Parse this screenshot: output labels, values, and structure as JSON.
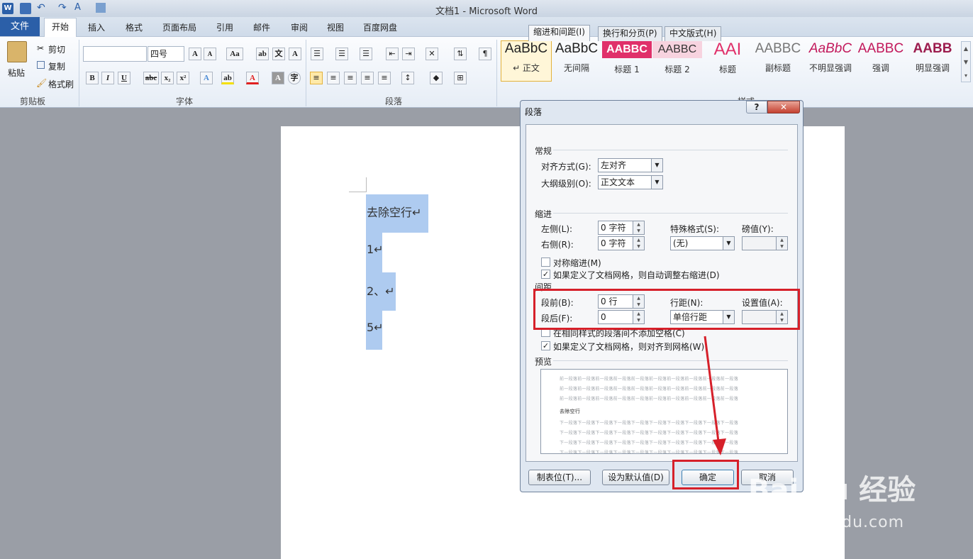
{
  "window": {
    "title": "文档1 - Microsoft Word"
  },
  "tabs": [
    "文件",
    "开始",
    "插入",
    "格式",
    "页面布局",
    "引用",
    "邮件",
    "审阅",
    "视图",
    "百度网盘"
  ],
  "ribbon": {
    "clipboard": {
      "paste": "粘贴",
      "cut": "剪切",
      "copy": "复制",
      "format_painter": "格式刷",
      "label": "剪贴板"
    },
    "font": {
      "font_name": "",
      "font_size": "四号",
      "label": "字体"
    },
    "paragraph": {
      "label": "段落"
    },
    "styles": {
      "label": "样式",
      "items": [
        {
          "sample": "AaBbC",
          "name": "↵ 正文",
          "color": "#222222"
        },
        {
          "sample": "AaBbC",
          "name": "无间隔",
          "color": "#222222"
        },
        {
          "sample": "AABBC",
          "name": "标题 1",
          "color": "#ffffff"
        },
        {
          "sample": "AABBC",
          "name": "标题 2",
          "color": "#333333"
        },
        {
          "sample": "AAI",
          "name": "标题",
          "color": "#e0306a"
        },
        {
          "sample": "AABBC",
          "name": "副标题",
          "color": "#777777"
        },
        {
          "sample": "AaBbC",
          "name": "不明显强调",
          "color": "#c2185b"
        },
        {
          "sample": "AABBC",
          "name": "强调",
          "color": "#c2185b"
        },
        {
          "sample": "AABB",
          "name": "明显强调",
          "color": "#9c1c4e"
        }
      ]
    }
  },
  "document": {
    "lines": [
      "去除空行↵",
      "1↵",
      "2、↵",
      "5↵"
    ]
  },
  "dialog": {
    "title": "段落",
    "help": "?",
    "close": "✕",
    "tabs": [
      "缩进和间距(I)",
      "换行和分页(P)",
      "中文版式(H)"
    ],
    "general": {
      "heading": "常规",
      "alignment_label": "对齐方式(G):",
      "alignment_value": "左对齐",
      "outline_label": "大纲级别(O):",
      "outline_value": "正文文本"
    },
    "indent": {
      "heading": "缩进",
      "left_label": "左侧(L):",
      "left_value": "0 字符",
      "right_label": "右侧(R):",
      "right_value": "0 字符",
      "special_label": "特殊格式(S):",
      "special_value": "(无)",
      "by_label": "磅值(Y):",
      "by_value": "",
      "mirror": "对称缩进(M)",
      "mirror_checked": false,
      "auto_adjust": "如果定义了文档网格，则自动调整右缩进(D)",
      "auto_adjust_checked": true
    },
    "spacing": {
      "heading": "间距",
      "before_label": "段前(B):",
      "before_value": "0 行",
      "after_label": "段后(F):",
      "after_value": "0",
      "line_label": "行距(N):",
      "line_value": "单倍行距",
      "at_label": "设置值(A):",
      "at_value": "",
      "no_space_same_style": "在相同样式的段落间不添加空格(C)",
      "no_space_checked": false,
      "snap_grid": "如果定义了文档网格，则对齐到网格(W)",
      "snap_grid_checked": true
    },
    "preview": {
      "heading": "预览",
      "sample_text": "去除空行",
      "prev_line": "前一段落前一段落前一段落前一段落前一段落前一段落前一段落前一段落前一段落前一段落",
      "next_line": "下一段落下一段落下一段落下一段落下一段落下一段落下一段落下一段落下一段落下一段落"
    },
    "buttons": {
      "tabs": "制表位(T)...",
      "default": "设为默认值(D)",
      "ok": "确定",
      "cancel": "取消"
    }
  },
  "watermark": {
    "brand": "Bai  du 经验",
    "url": "jingyan.baidu.com"
  }
}
